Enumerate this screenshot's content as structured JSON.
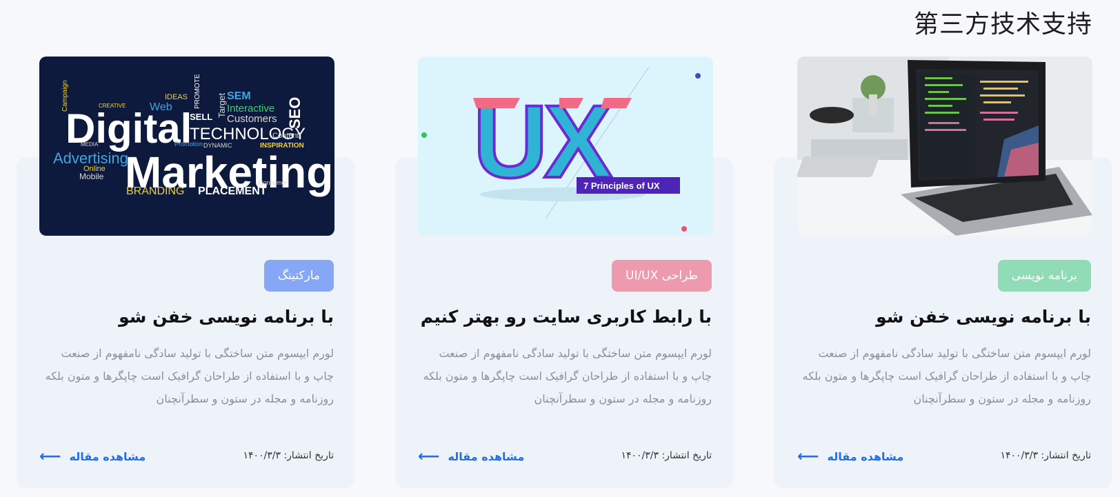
{
  "section": {
    "title": "第三方技术支持"
  },
  "cards": [
    {
      "tag": "برنامه نویسی",
      "tag_color": "#8fdcb6",
      "title": "با برنامه نویسی خفن شو",
      "text": "لورم ایپسوم متن ساختگی با تولید سادگی نامفهوم از صنعت چاپ و با استفاده از طراحان گرافیک است چاپگرها و متون بلکه روزنامه و مجله در ستون و سطرآنچنان",
      "date": "تاریخ انتشار: ۱۴۰۰/۳/۳",
      "link": "مشاهده مقاله",
      "image_icon": "laptop-code-image"
    },
    {
      "tag": "طراحی UI/UX",
      "tag_color": "#ee9aae",
      "title": "با رابط کاربری سایت رو بهتر کنیم",
      "text": "لورم ایپسوم متن ساختگی با تولید سادگی نامفهوم از صنعت چاپ و با استفاده از طراحان گرافیک است چاپگرها و متون بلکه روزنامه و مجله در ستون و سطرآنچنان",
      "date": "تاریخ انتشار: ۱۴۰۰/۳/۳",
      "link": "مشاهده مقاله",
      "image_icon": "ux-principles-image",
      "image_text": {
        "big": "UX",
        "caption": "7 Principles of UX"
      }
    },
    {
      "tag": "مارکتینگ",
      "tag_color": "#85a7f5",
      "title": "با برنامه نویسی خفن شو",
      "text": "لورم ایپسوم متن ساختگی با تولید سادگی نامفهوم از صنعت چاپ و با استفاده از طراحان گرافیک است چاپگرها و متون بلکه روزنامه و مجله در ستون و سطرآنچنان",
      "date": "تاریخ انتشار: ۱۴۰۰/۳/۳",
      "link": "مشاهده مقاله",
      "image_icon": "digital-marketing-image",
      "image_text": {
        "w1": "Digital",
        "w2": "Marketing",
        "w3": "TECHNOLOGY",
        "w4": "Advertising",
        "w5": "BRANDING",
        "w6": "PLACEMENT",
        "w7": "SEO",
        "w8": "Interactive",
        "w9": "Customers",
        "w10": "SEM",
        "w11": "Web",
        "w12": "IDEAS",
        "w13": "SELL",
        "w14": "Target",
        "w15": "Online",
        "w16": "Mobile",
        "w17": "Content",
        "w18": "INSPIRATION",
        "w19": "DYNAMIC",
        "w20": "Promotion",
        "w21": "Consumer",
        "w22": "Campaign",
        "w23": "CREATIVE",
        "w24": "MEDIA",
        "w25": "PROMOTE"
      }
    }
  ]
}
